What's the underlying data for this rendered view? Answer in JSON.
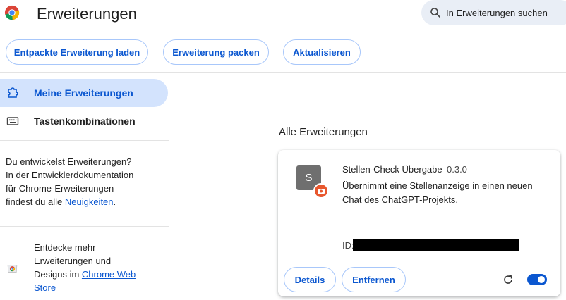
{
  "header": {
    "title": "Erweiterungen",
    "search_placeholder": "In Erweiterungen suchen",
    "logo_icon": "chrome-logo-icon"
  },
  "toolbar": {
    "load_unpacked": "Entpackte Erweiterung laden",
    "pack": "Erweiterung packen",
    "update": "Aktualisieren"
  },
  "sidebar": {
    "items": [
      {
        "label": "Meine Erweiterungen",
        "icon": "puzzle-icon",
        "active": true
      },
      {
        "label": "Tastenkombinationen",
        "icon": "keyboard-icon",
        "active": false
      }
    ],
    "dev_text_1": "Du entwickelst Erweiterungen?",
    "dev_text_2": "In der Entwicklerdokumentation",
    "dev_text_3": "für Chrome-Erweiterungen",
    "dev_text_4": "findest du alle",
    "dev_link": "Neuigkeiten",
    "dev_text_5": ".",
    "store_text_1": "Entdecke mehr",
    "store_text_2": "Erweiterungen und",
    "store_text_3": "Designs im",
    "store_link_1": "Chrome Web",
    "store_link_2": "Store"
  },
  "main": {
    "section_title": "Alle Erweiterungen",
    "extension": {
      "icon_letter": "S",
      "name": "Stellen-Check Übergabe",
      "version": "0.3.0",
      "description": "Übernimmt eine Stellenanzeige in einen neuen Chat des ChatGPT-Projekts.",
      "id_label": "ID:",
      "details_label": "Details",
      "remove_label": "Entfernen",
      "enabled": true
    }
  },
  "colors": {
    "accent": "#0b57d0",
    "active_nav_bg": "#d3e3fd",
    "search_bg": "#e9eef6",
    "badge": "#e8572e"
  }
}
